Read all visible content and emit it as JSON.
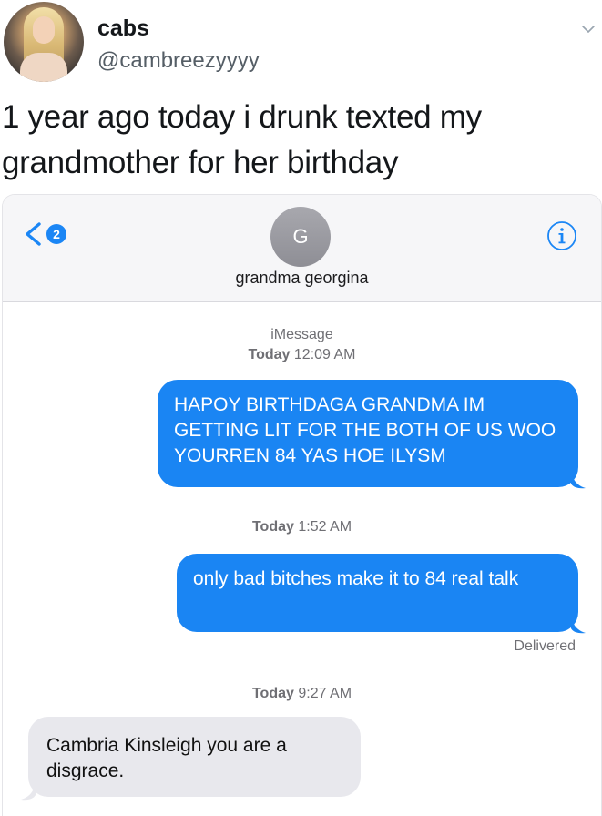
{
  "tweet": {
    "display_name": "cabs",
    "handle": "@cambreezyyyy",
    "text": "1 year ago today i drunk texted my grandmother for her birthday",
    "menu_icon": "chevron-down-icon"
  },
  "imessage": {
    "back_badge": "2",
    "contact_initial": "G",
    "contact_name": "grandma georgina",
    "info_icon": "info-icon",
    "service_label": "iMessage",
    "messages": [
      {
        "timestamp_day": "Today",
        "timestamp_time": "12:09 AM",
        "direction": "outgoing",
        "text": "HAPOY BIRTHDAGA GRANDMA IM GETTING LIT FOR THE BOTH OF US WOO YOURREN 84 YAS HOE ILYSM"
      },
      {
        "timestamp_day": "Today",
        "timestamp_time": "1:52 AM",
        "direction": "outgoing",
        "text": "only bad bitches make it to 84 real talk",
        "status": "Delivered"
      },
      {
        "timestamp_day": "Today",
        "timestamp_time": "9:27 AM",
        "direction": "incoming",
        "text": "Cambria Kinsleigh you are a disgrace."
      }
    ]
  },
  "colors": {
    "outgoing_bubble": "#1a85f3",
    "incoming_bubble": "#e8e8ed",
    "accent": "#1b86f5"
  }
}
